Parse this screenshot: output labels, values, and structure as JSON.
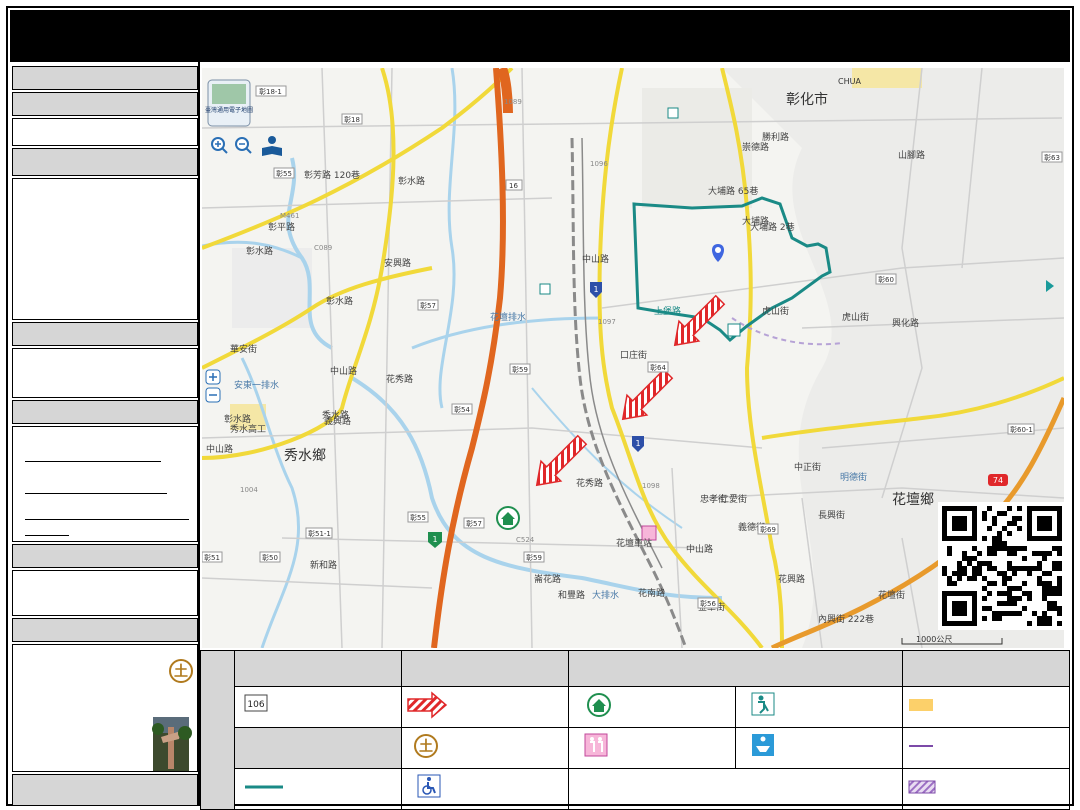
{
  "map": {
    "place_labels": {
      "changhua_city": "彰化市",
      "xiushui_township": "秀水鄉",
      "huatan_township": "花壇鄉",
      "chua": "CHUA"
    },
    "road_labels": {
      "zhongshan_rd": "中山路",
      "zhongshan_rd_2": "中山路",
      "zhongshan_rd_3": "中山路",
      "zhongshan_rd_4": "中山路",
      "huaxiu_rd": "花秀路",
      "huaxiu_rd_2": "花秀路",
      "huanan_rd": "花南路",
      "huatan_st": "花壇街",
      "huaxing_rd": "花興路",
      "huatan_drain": "花壇排水",
      "anzhou_drain": "安東一排水",
      "dabu_rd_65": "大埔路 65巷",
      "dabu_rd_2": "大埔路 2巷",
      "hushan_st": "虎山街",
      "hushan_st_2": "虎山街",
      "zhangshui_rd": "彰水路",
      "zhangshui_rd_2": "彰水路",
      "zhangshui_rd_3": "彰水路",
      "zhangping_rd": "彰平路",
      "xiushui_rd": "秀水路",
      "anxing_rd": "安興路",
      "yijing_rd": "義興路",
      "jinhua_st": "金華街",
      "zhongzheng_st": "中正街",
      "changxing_st": "長興街",
      "neipu_st": "內興街 222巷",
      "zhangfang_rd": "彰芳路 120巷",
      "huaan_st": "華安街",
      "dapu_rd": "大埔路",
      "xinghua_rd": "興化路",
      "lunhua_rd": "崙花路",
      "shangbao_road": "上堡路",
      "kouzhuang": "口庄街",
      "shanjiao": "山腳路",
      "chongde": "崇德路",
      "renai": "仁愛街",
      "zhongxiao": "忠孝街",
      "yide": "義德街",
      "xiushui_gongyao": "秀水高工",
      "huatan_rail": "花壇車站",
      "dapu_drain": "大排水",
      "shengli": "勝利路",
      "xinhe": "新和路",
      "hefeng": "和豐路",
      "mingde": "明德街"
    },
    "route_shields": [
      "彰18-1",
      "彰18",
      "彰55",
      "彰57",
      "彰59",
      "彰54",
      "彰56",
      "彰55",
      "彰57",
      "彰59",
      "彰51",
      "彰51-1",
      "彰50",
      "彰64",
      "彰63",
      "彰60-1",
      "彰69",
      "彰60",
      "M461",
      "C089",
      "1089",
      "1096",
      "1097",
      "1098",
      "1004",
      "C524",
      "16"
    ],
    "highway_shield_1": "1",
    "highway_shield_2": "1",
    "highway_shield_3": "1",
    "highway_74": "74",
    "scale_bar": "1000公尺",
    "map_brand": "臺灣通用電子地圖",
    "zoom_in_icon": "zoom-in-icon",
    "zoom_out_icon": "zoom-out-icon",
    "book_icon": "book-icon"
  },
  "legend": {
    "route_number_sample": "106"
  }
}
